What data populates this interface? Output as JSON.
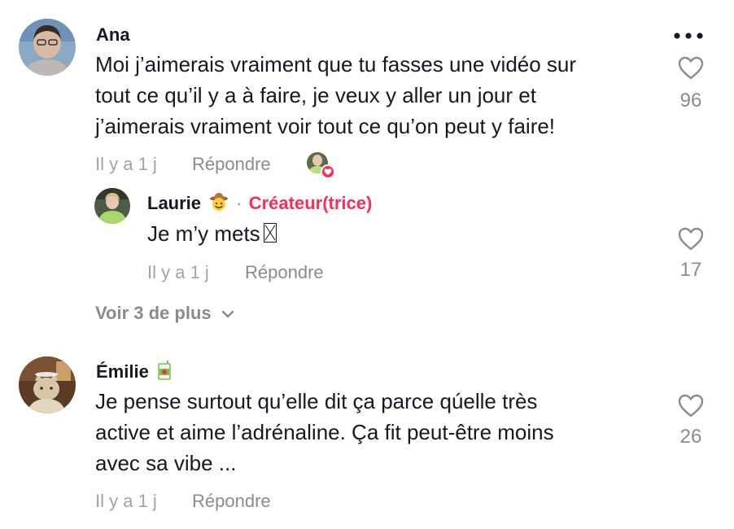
{
  "comments": [
    {
      "username": "Ana",
      "lines": [
        "Moi j’aimerais vraiment que tu fasses une vidéo sur",
        "tout ce qu’il y a à faire, je veux y aller un jour et",
        "j’aimerais vraiment voir tout ce qu’on peut y faire!"
      ],
      "time": "Il y a 1 j",
      "reply_label": "Répondre",
      "likes": "96",
      "liked_by_creator": true,
      "replies": [
        {
          "username": "Laurie",
          "user_emoji": "cowboy-face",
          "separator": "·",
          "badge": "Créateur(trice)",
          "text": "Je m’y mets",
          "time": "Il y a 1 j",
          "reply_label": "Répondre",
          "likes": "17"
        }
      ],
      "view_more_label": "Voir 3 de plus"
    },
    {
      "username": "Émilie",
      "user_emoji": "juice-box",
      "lines": [
        "Je pense surtout qu’elle dit ça parce qúelle très",
        "active et aime l’adrénaline. Ça fit peut-être moins",
        "avec sa vibe ..."
      ],
      "time": "Il y a 1 j",
      "reply_label": "Répondre",
      "likes": "26"
    }
  ],
  "colors": {
    "creator_badge": "#fe2c55",
    "meta_text": "#a0a3aa",
    "icon_gray": "#8a8b91",
    "text": "#161823"
  }
}
